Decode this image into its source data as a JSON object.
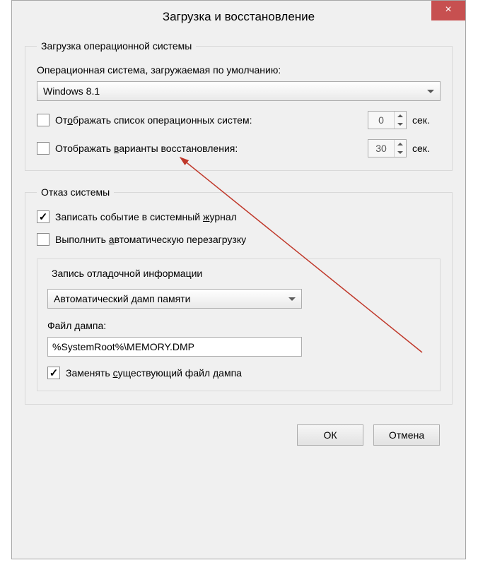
{
  "window": {
    "title": "Загрузка и восстановление",
    "close_glyph": "×"
  },
  "boot": {
    "legend": "Загрузка операционной системы",
    "default_os_label": "Операционная система, загружаемая по умолчанию:",
    "default_os_value": "Windows 8.1",
    "show_os_list_label_pre": "От",
    "show_os_list_label_u": "о",
    "show_os_list_label_post": "бражать список операционных систем:",
    "show_os_list_value": "0",
    "show_recovery_label_pre": "Отображать ",
    "show_recovery_label_u": "в",
    "show_recovery_label_post": "арианты восстановления:",
    "show_recovery_value": "30",
    "seconds_unit": "сек."
  },
  "failure": {
    "legend": "Отказ системы",
    "log_event_label_pre": "Записать событие в системный ",
    "log_event_label_u": "ж",
    "log_event_label_post": "урнал",
    "auto_restart_label_pre": "Выполнить ",
    "auto_restart_label_u": "а",
    "auto_restart_label_post": "втоматическую перезагрузку",
    "debug_legend": "Запись отладочной информации",
    "dump_type": "Автоматический дамп памяти",
    "dump_file_label": "Файл дампа:",
    "dump_file_value": "%SystemRoot%\\MEMORY.DMP",
    "overwrite_label_pre": "Заменять ",
    "overwrite_label_u": "с",
    "overwrite_label_post": "уществующий файл дампа"
  },
  "buttons": {
    "ok": "ОК",
    "cancel": "Отмена"
  }
}
